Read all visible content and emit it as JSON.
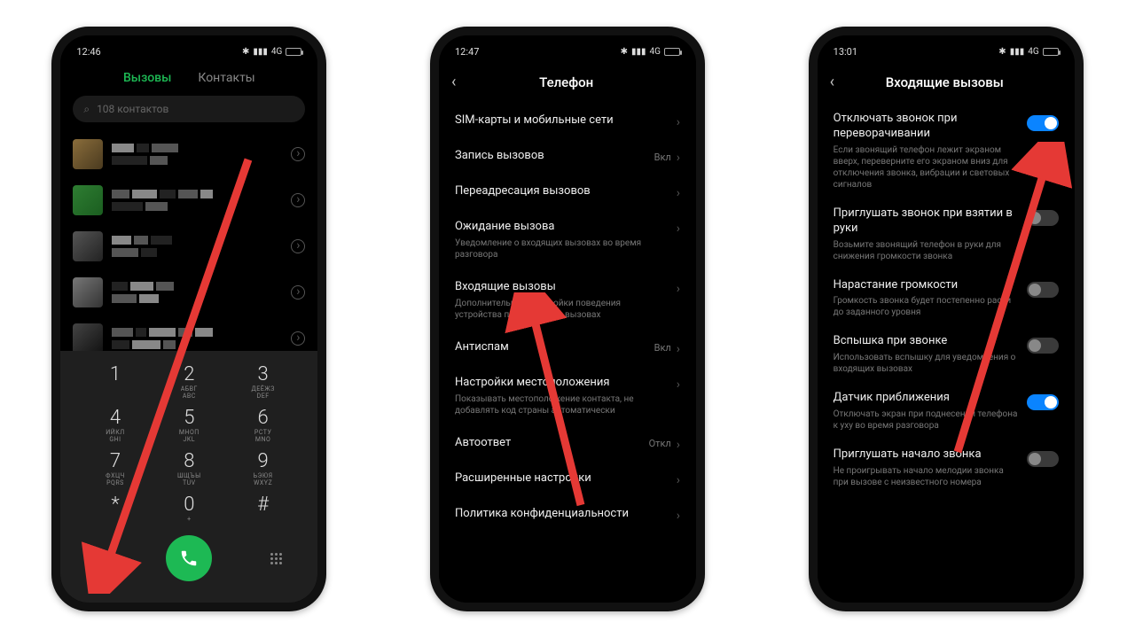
{
  "s1": {
    "time": "12:46",
    "net": "4G",
    "tab_calls": "Вызовы",
    "tab_contacts": "Контакты",
    "search_placeholder": "108 контактов",
    "dial": [
      {
        "n": "1",
        "s": ""
      },
      {
        "n": "2",
        "s": "АБВГ\nABC"
      },
      {
        "n": "3",
        "s": "ДЕЁЖЗ\nDEF"
      },
      {
        "n": "4",
        "s": "ИЙКЛ\nGHI"
      },
      {
        "n": "5",
        "s": "МНОП\nJKL"
      },
      {
        "n": "6",
        "s": "РСТУ\nMNO"
      },
      {
        "n": "7",
        "s": "ФХЦЧ\nPQRS"
      },
      {
        "n": "8",
        "s": "ШЩЪЫ\nTUV"
      },
      {
        "n": "9",
        "s": "ЬЭЮЯ\nWXYZ"
      },
      {
        "n": "*",
        "s": ""
      },
      {
        "n": "0",
        "s": "+"
      },
      {
        "n": "#",
        "s": ""
      }
    ]
  },
  "s2": {
    "time": "12:47",
    "net": "4G",
    "title": "Телефон",
    "val_on": "Вкл",
    "val_off": "Откл",
    "items": [
      {
        "t": "SIM-карты и мобильные сети",
        "d": "",
        "v": ""
      },
      {
        "t": "Запись вызовов",
        "d": "",
        "v": "Вкл"
      },
      {
        "t": "Переадресация вызовов",
        "d": "",
        "v": ""
      },
      {
        "t": "Ожидание вызова",
        "d": "Уведомление о входящих вызовах во время разговора",
        "v": ""
      },
      {
        "t": "Входящие вызовы",
        "d": "Дополнительные настройки поведения устройства при входящих вызовах",
        "v": ""
      },
      {
        "t": "Антиспам",
        "d": "",
        "v": "Вкл"
      },
      {
        "t": "Настройки местоположения",
        "d": "Показывать местоположение контакта, не добавлять код страны автоматически",
        "v": ""
      },
      {
        "t": "Автоответ",
        "d": "",
        "v": "Откл"
      },
      {
        "t": "Расширенные настройки",
        "d": "",
        "v": ""
      },
      {
        "t": "Политика конфиденциальности",
        "d": "",
        "v": ""
      }
    ]
  },
  "s3": {
    "time": "13:01",
    "net": "4G",
    "title": "Входящие вызовы",
    "items": [
      {
        "t": "Отключать звонок при переворачивании",
        "d": "Если звонящий телефон лежит экраном вверх, переверните его экраном вниз для отключения звонка, вибрации и световых сигналов",
        "on": true
      },
      {
        "t": "Приглушать звонок при взятии в руки",
        "d": "Возьмите звонящий телефон в руки для снижения громкости звонка",
        "on": false
      },
      {
        "t": "Нарастание громкости",
        "d": "Громкость звонка будет постепенно расти до заданного уровня",
        "on": false
      },
      {
        "t": "Вспышка при звонке",
        "d": "Использовать вспышку для уведомления о входящих вызовах",
        "on": false
      },
      {
        "t": "Датчик приближения",
        "d": "Отключать экран при поднесении телефона к уху во время разговора",
        "on": true
      },
      {
        "t": "Приглушать начало звонка",
        "d": "Не проигрывать начало мелодии звонка при вызове с неизвестного номера",
        "on": false
      }
    ]
  }
}
